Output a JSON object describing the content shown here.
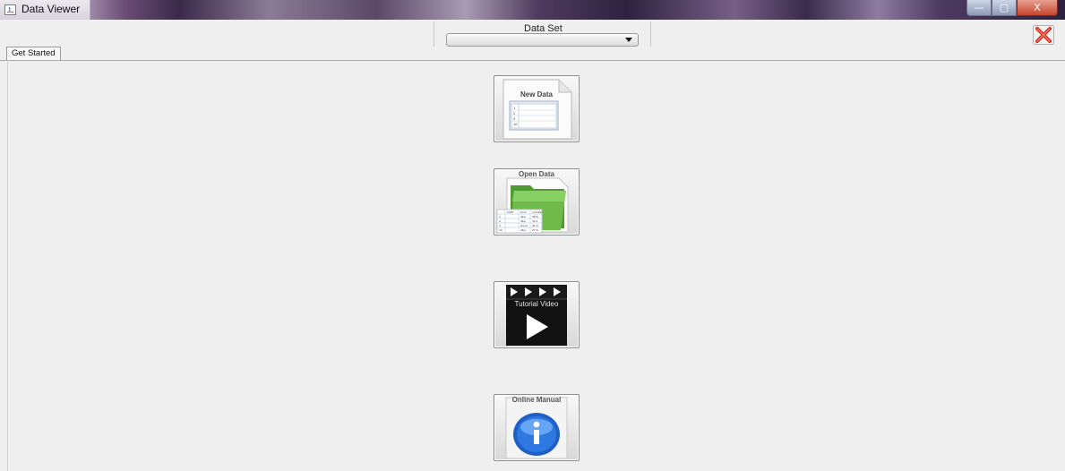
{
  "window": {
    "title": "Data Viewer",
    "buttons": {
      "minimize": "—",
      "maximize": "▢",
      "close": "X"
    }
  },
  "toolbar": {
    "dataset_label": "Data Set",
    "dataset_value": ""
  },
  "tabs": [
    {
      "label": "Get Started"
    }
  ],
  "tiles": {
    "new_data": {
      "label": "New Data",
      "rows": [
        "1",
        "2",
        "3",
        "10"
      ]
    },
    "open_data": {
      "label": "Open Data",
      "table_header": [
        "COM",
        "bom",
        "number"
      ],
      "table_rows": [
        [
          "1",
          "4ba",
          "38.6"
        ],
        [
          "2",
          "4ba",
          "32.1"
        ],
        [
          "3",
          "Good",
          "41.0"
        ],
        [
          "10",
          "4ba",
          "27.5"
        ]
      ]
    },
    "tutorial_video": {
      "label": "Tutorial Video"
    },
    "online_manual": {
      "label": "Online Manual"
    }
  },
  "colors": {
    "title_gradient_dark": "#3b2a4a",
    "folder_green": "#6fba4a",
    "info_blue": "#1f5fc6"
  }
}
